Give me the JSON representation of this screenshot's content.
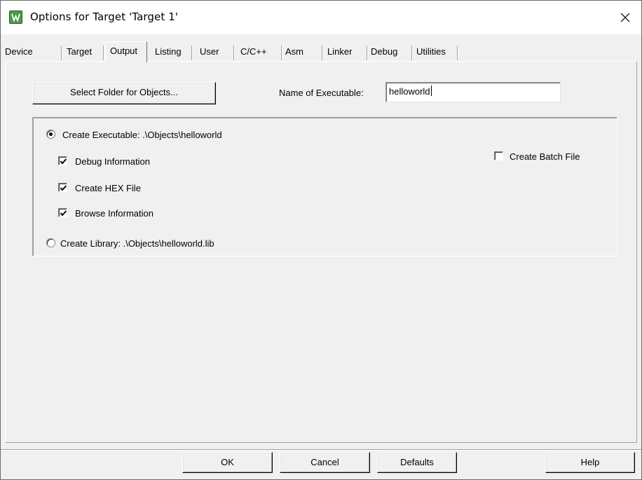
{
  "window": {
    "title": "Options for Target 'Target 1'",
    "icon": "keil-uvision-icon",
    "close_glyph": "✕"
  },
  "tabs": [
    {
      "label": "Device",
      "active": false
    },
    {
      "label": "Target",
      "active": false
    },
    {
      "label": "Output",
      "active": true
    },
    {
      "label": "Listing",
      "active": false
    },
    {
      "label": "User",
      "active": false
    },
    {
      "label": "C/C++",
      "active": false
    },
    {
      "label": "Asm",
      "active": false
    },
    {
      "label": "Linker",
      "active": false
    },
    {
      "label": "Debug",
      "active": false
    },
    {
      "label": "Utilities",
      "active": false
    }
  ],
  "output": {
    "select_folder_label": "Select Folder for Objects...",
    "name_of_executable_label": "Name of Executable:",
    "name_of_executable_value": "helloworld",
    "create_executable_label": "Create Executable:  .\\Objects\\helloworld",
    "create_executable_selected": true,
    "debug_information_label": "Debug Information",
    "debug_information_checked": true,
    "create_hex_label": "Create HEX File",
    "create_hex_checked": true,
    "browse_information_label": "Browse Information",
    "browse_information_checked": true,
    "create_library_label": "Create Library:  .\\Objects\\helloworld.lib",
    "create_library_selected": false,
    "create_batch_label": "Create Batch File",
    "create_batch_checked": false
  },
  "footer": {
    "ok_label": "OK",
    "cancel_label": "Cancel",
    "defaults_label": "Defaults",
    "help_label": "Help"
  }
}
